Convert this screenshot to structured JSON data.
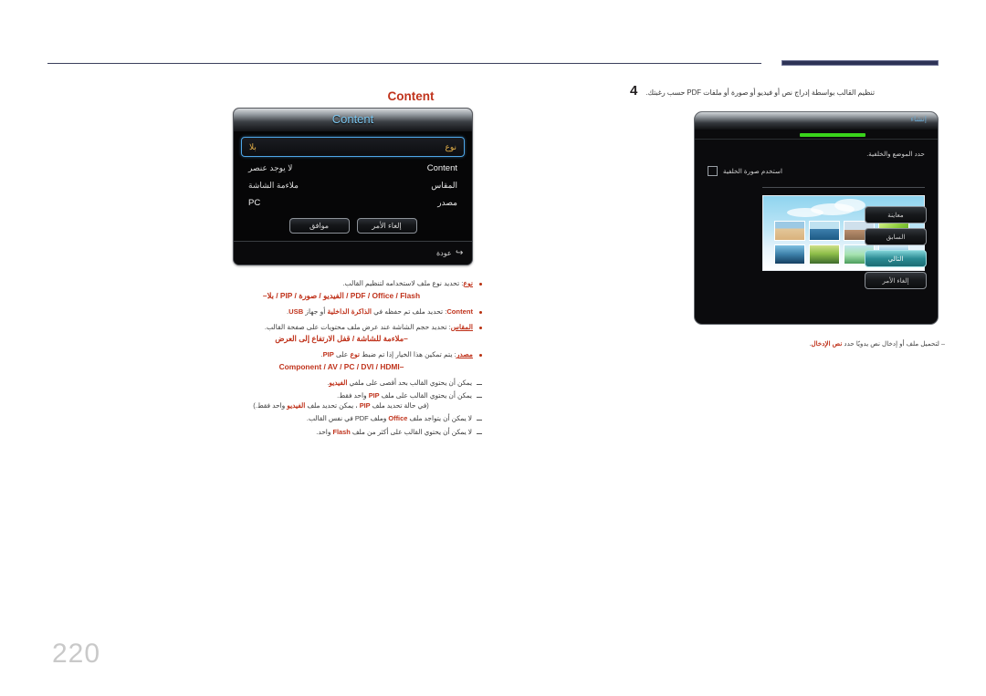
{
  "page": {
    "number": "220",
    "accent_red": "#c0341d",
    "rule_color": "#3a3f5c"
  },
  "left": {
    "heading": "Content",
    "osd": {
      "title": "Content",
      "rows": [
        {
          "key": "نوع",
          "value": "بلا",
          "selected": true,
          "value_ltr": false,
          "key_ltr": false
        },
        {
          "key": "Content",
          "value": "لا يوجد عنصر",
          "selected": false,
          "value_ltr": false,
          "key_ltr": true
        },
        {
          "key": "المقاس",
          "value": "ملاءمة الشاشة",
          "selected": false,
          "value_ltr": false,
          "key_ltr": false
        },
        {
          "key": "مصدر",
          "value": "PC",
          "selected": false,
          "value_ltr": true,
          "key_ltr": false
        }
      ],
      "buttons": [
        {
          "label": "موافق"
        },
        {
          "label": "إلغاء الأمر"
        }
      ],
      "footer_return": "عودة",
      "return_icon": "return-arrow-icon"
    },
    "bullets": [
      {
        "line1_parts": [
          {
            "t": "نوع",
            "style": "redu"
          },
          {
            "t": ": تحديد نوع ملف لاستخدامه لتنظيم القالب.",
            "style": "plain"
          }
        ],
        "line2": "–بلا / PIP / الفيديو / صورة / PDF / Office / Flash",
        "line2_dir": "rtl"
      },
      {
        "line1_parts": [
          {
            "t": "Content",
            "style": "red-ltr"
          },
          {
            "t": ": تحديد ملف تم حفظه في ",
            "style": "plain"
          },
          {
            "t": "الذاكرة الداخلية",
            "style": "red"
          },
          {
            "t": " أو جهاز ",
            "style": "plain"
          },
          {
            "t": "USB",
            "style": "red-ltr"
          },
          {
            "t": ".",
            "style": "plain"
          }
        ],
        "line2": "",
        "line2_dir": "rtl"
      },
      {
        "line1_parts": [
          {
            "t": "المقاس",
            "style": "redu"
          },
          {
            "t": ": تحديد حجم الشاشة عند عرض ملف محتويات على صفحة القالب.",
            "style": "plain"
          }
        ],
        "line2": "–ملاءمة للشاشة / قفل الارتفاع إلى العرض",
        "line2_dir": "rtl"
      },
      {
        "line1_parts": [
          {
            "t": "مصدر",
            "style": "redu"
          },
          {
            "t": ": يتم تمكين هذا الخيار إذا تم ضبط ",
            "style": "plain"
          },
          {
            "t": "نوع",
            "style": "red"
          },
          {
            "t": " على ",
            "style": "plain"
          },
          {
            "t": "PIP",
            "style": "red-ltr"
          },
          {
            "t": ".",
            "style": "plain"
          }
        ],
        "line2": "Component / AV / PC / DVI / HDMI–",
        "line2_dir": "ltr"
      }
    ],
    "dashes": [
      {
        "parts": [
          {
            "t": "يمكن أن يحتوي القالب بحد أقصى على ملف ",
            "style": "plain"
          },
          {
            "t": "الفيديو",
            "style": "red"
          },
          {
            "t": ".",
            "style": "plain"
          }
        ],
        "sub": ""
      },
      {
        "parts": [
          {
            "t": "يمكن أن يحتوي القالب على ملف ",
            "style": "plain"
          },
          {
            "t": "PIP",
            "style": "red-ltr"
          },
          {
            "t": " واحد فقط.",
            "style": "plain"
          }
        ],
        "sub_parts": [
          {
            "t": "(في حالة تحديد ملف ",
            "style": "plain"
          },
          {
            "t": "PIP",
            "style": "red-ltr"
          },
          {
            "t": " ، يمكن تحديد ملف ",
            "style": "plain"
          },
          {
            "t": "الفيديو",
            "style": "red"
          },
          {
            "t": " واحد فقط.)",
            "style": "plain"
          }
        ]
      },
      {
        "parts": [
          {
            "t": "لا يمكن أن يتواجد ملف ",
            "style": "plain"
          },
          {
            "t": "Office",
            "style": "red-ltr"
          },
          {
            "t": " وملف ",
            "style": "plain"
          },
          {
            "t": "PDF",
            "style": "plain-ltr"
          },
          {
            "t": " في نفس القالب.",
            "style": "plain"
          }
        ],
        "sub": ""
      },
      {
        "parts": [
          {
            "t": "لا يمكن أن يحتوي القالب على أكثر من ملف ",
            "style": "plain"
          },
          {
            "t": "Flash",
            "style": "red-ltr"
          },
          {
            "t": " واحد.",
            "style": "plain"
          }
        ],
        "sub": ""
      }
    ]
  },
  "right": {
    "step_number": "4",
    "step_text": "تنظيم القالب بواسطة إدراج نص أو فيديو أو صورة أو ملفات PDF حسب رغبتك.",
    "wizard": {
      "title": "إنشاء",
      "progress_color": "#39d41b",
      "instruction": "حدد الموضع والخلفية.",
      "checkbox_label": "استخدم صورة الخلفية",
      "checkbox_checked": false,
      "buttons": [
        {
          "label": "معاينة",
          "active": false
        },
        {
          "label": "السابق",
          "active": false
        },
        {
          "label": "التالي",
          "active": true
        },
        {
          "label": "إلغاء الأمر",
          "active": false
        }
      ],
      "thumbnails": [
        {
          "name": "people-beach-thumb",
          "c1": "#f2c7a8",
          "c2": "#7ab3d6",
          "c3": "#d9b27c"
        },
        {
          "name": "boat-sea-thumb",
          "c1": "#9fd2ea",
          "c2": "#2b6f9e",
          "c3": "#e7f2f7"
        },
        {
          "name": "family-outdoor-thumb",
          "c1": "#cfe0ec",
          "c2": "#b98f6e",
          "c3": "#86b4d3"
        },
        {
          "name": "green-leaves-thumb",
          "c1": "#b4e05a",
          "c2": "#5fae2a",
          "c3": "#dff3a8"
        },
        {
          "name": "snorkel-thumb",
          "c1": "#6fb8de",
          "c2": "#1d4f77",
          "c3": "#a8d6ec"
        },
        {
          "name": "castle-field-thumb",
          "c1": "#8fbf4a",
          "c2": "#2f5a2a",
          "c3": "#cfe08a"
        },
        {
          "name": "flowers-sky-thumb",
          "c1": "#a7e3b0",
          "c2": "#4a9c5c",
          "c3": "#d9f2de"
        },
        {
          "name": "birds-sea-thumb",
          "c1": "#bfe4f2",
          "c2": "#2a6f9c",
          "c3": "#e8f5fb"
        }
      ]
    },
    "note_parts": [
      {
        "t": "– لتحميل ملف أو إدخال نص يدويًا حدد ",
        "style": "plain"
      },
      {
        "t": "نص الإدخال",
        "style": "red"
      },
      {
        "t": ".",
        "style": "plain"
      }
    ]
  }
}
